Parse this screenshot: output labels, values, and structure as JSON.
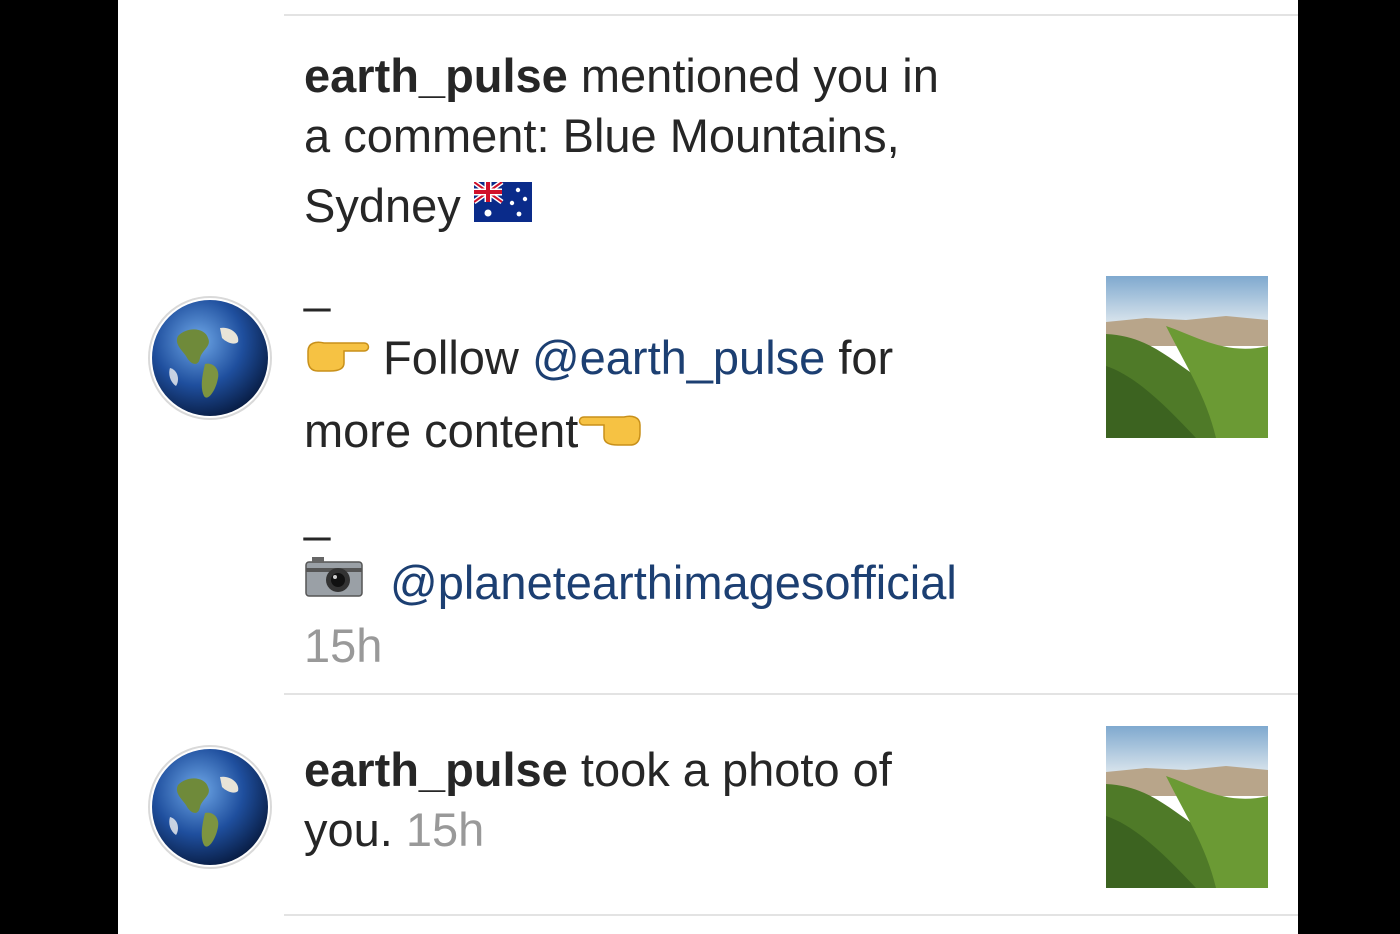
{
  "notifications": [
    {
      "username": "earth_pulse",
      "action_text": " mentioned you in",
      "line2": "a comment: Blue Mountains,",
      "line3": "Sydney ",
      "flag_icon": "australia-flag",
      "dash1": "_",
      "follow_prefix": " Follow ",
      "follow_mention": "@earth_pulse",
      "follow_suffix": " for",
      "more_content": "more content",
      "dash2": "_",
      "camera_mention": "@planetearthimagesofficial",
      "time": "15h"
    },
    {
      "username": "earth_pulse",
      "action_text": " took a photo of",
      "line2": "you. ",
      "time": "15h"
    }
  ],
  "colors": {
    "mention": "#1c3f72",
    "timestamp": "#999999",
    "text": "#262626",
    "divider": "#e3e3e3"
  }
}
